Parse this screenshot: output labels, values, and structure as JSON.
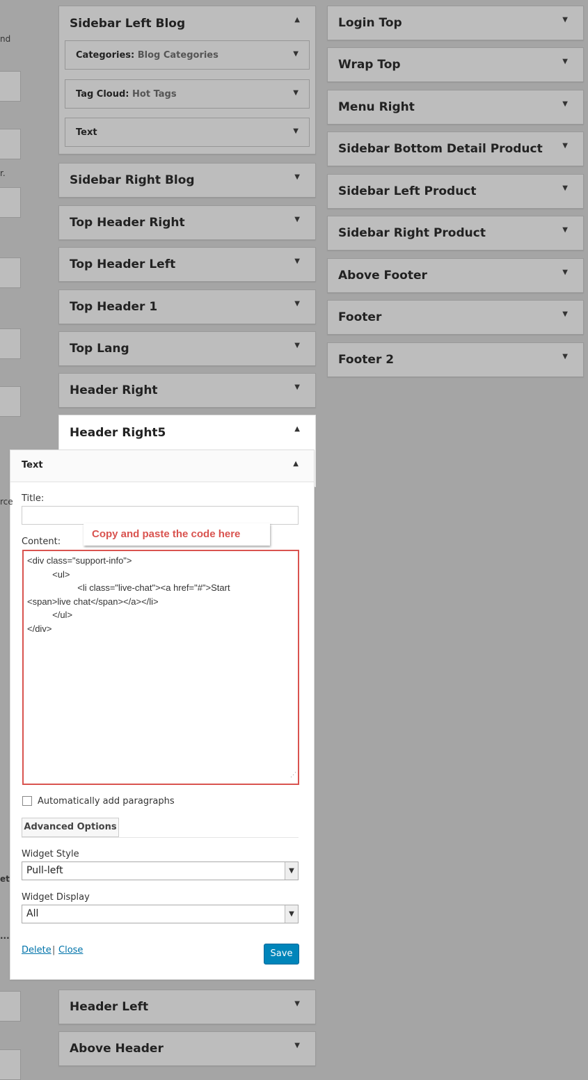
{
  "left_column": {
    "fragments": [
      "nd",
      "r.",
      "rce",
      "et",
      "..."
    ]
  },
  "middle_areas": {
    "sidebar_left_blog": {
      "title": "Sidebar Left Blog",
      "widgets": [
        {
          "name": "Categories:",
          "sub": "Blog Categories"
        },
        {
          "name": "Tag Cloud:",
          "sub": "Hot Tags"
        },
        {
          "name": "Text",
          "sub": ""
        }
      ]
    },
    "collapsed": [
      "Sidebar Right Blog",
      "Top Header Right",
      "Top Header Left",
      "Top Header 1",
      "Top Lang",
      "Header Right"
    ],
    "open_area_title": "Header Right5",
    "below": [
      "Header Left",
      "Above Header"
    ]
  },
  "right_areas": [
    "Login Top",
    "Wrap Top",
    "Menu Right",
    "Sidebar Bottom Detail Product",
    "Sidebar Left Product",
    "Sidebar Right Product",
    "Above Footer",
    "Footer",
    "Footer 2"
  ],
  "widget_panel": {
    "header": "Text",
    "title_label": "Title:",
    "title_value": "",
    "content_label": "Content:",
    "callout": "Copy and paste the code here",
    "code_lines": [
      "<div class=\"support-info\">",
      "          <ul>",
      "                    <li class=\"live-chat\"><a href=\"#\">Start",
      "<span>live chat</span></a></li>",
      "          </ul>",
      "</div>"
    ],
    "auto_paragraphs_label": "Automatically add paragraphs",
    "auto_paragraphs_checked": false,
    "advanced_button": "Advanced Options",
    "widget_style_label": "Widget Style",
    "widget_style_value": "Pull-left",
    "widget_display_label": "Widget Display",
    "widget_display_value": "All",
    "delete_link": "Delete",
    "separator": "|",
    "close_link": "Close",
    "save_button": "Save"
  },
  "icons": {
    "collapse": "triangle-up",
    "expand": "triangle-down"
  },
  "colors": {
    "callout_red": "#d9534f",
    "save_blue": "#0085ba",
    "link_blue": "#0073aa",
    "overlay_gray": "#a5a5a5"
  }
}
